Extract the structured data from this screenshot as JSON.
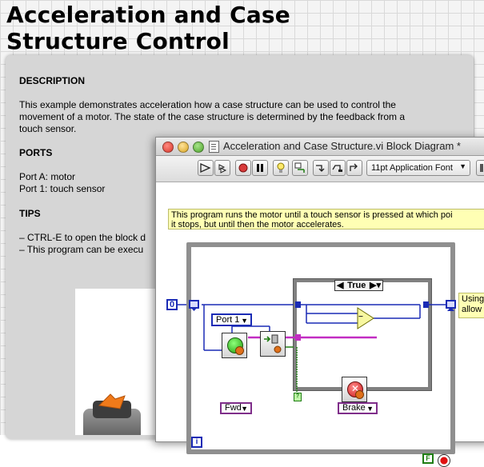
{
  "page": {
    "title": "Acceleration and Case\nStructure Control"
  },
  "description": {
    "heading": "DESCRIPTION",
    "text_lines": [
      "This example demonstrates acceleration how a case structure can be used to control the",
      "movement of a motor. The state of the case structure is determined by the feedback from a",
      "touch sensor."
    ],
    "ports_heading": "PORTS",
    "ports": [
      "Port A: motor",
      "Port 1: touch sensor"
    ],
    "tips_heading": "TIPS",
    "tips": [
      "– CTRL-E to open the block d",
      "– This program can be execu"
    ]
  },
  "window": {
    "title": "Acceleration and Case Structure.vi Block Diagram *",
    "toolbar": {
      "font_select": "11pt Application Font"
    },
    "diagram": {
      "comment_lines": [
        "This program runs the motor until a touch sensor is  pressed at which poi",
        "it stops,  but until then the motor accelerates."
      ],
      "side_comment_lines": [
        "Using",
        "allow"
      ],
      "case_selector": "True",
      "numeric_constant": "0",
      "port_constant": "Port 1",
      "fwd_enum": "Fwd",
      "brake_enum": "Brake",
      "subtract_glyph": "−",
      "iteration_terminal": "i",
      "bool_constant": "F",
      "bool_tunnel": "?"
    }
  },
  "colors": {
    "numeric_wire": "#1a2bb5",
    "enum_wire": "#c22dc2",
    "bool_wire": "#1f7d12",
    "comment_bg": "#ffffb4"
  }
}
